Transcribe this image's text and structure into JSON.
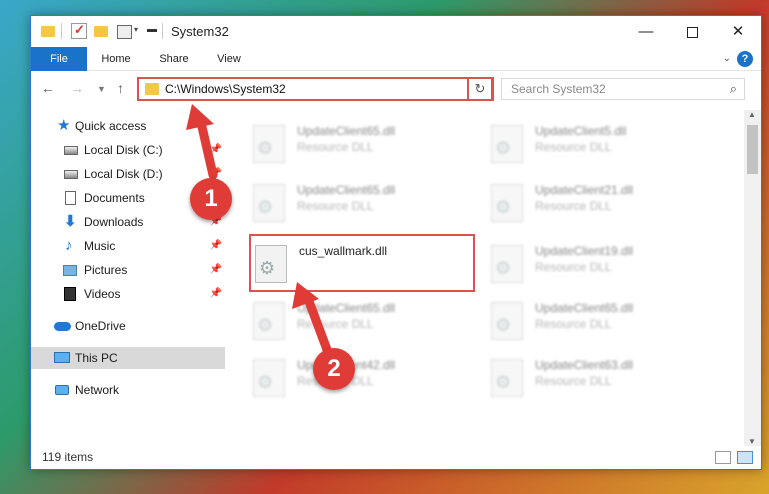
{
  "window": {
    "title": "System32",
    "buttons": {
      "minimize": "—",
      "close": "✕"
    }
  },
  "ribbon": {
    "tabs": [
      "File",
      "Home",
      "Share",
      "View"
    ],
    "help": "?"
  },
  "navigation": {
    "address": "C:\\Windows\\System32",
    "search_placeholder": "Search System32"
  },
  "nav_pane": {
    "items": [
      {
        "label": "Quick access",
        "icon": "star-icon"
      },
      {
        "label": "Local Disk (C:)",
        "icon": "disk-icon",
        "pinned": true
      },
      {
        "label": "Local Disk (D:)",
        "icon": "disk-icon",
        "pinned": true
      },
      {
        "label": "Documents",
        "icon": "documents-icon",
        "pinned": true
      },
      {
        "label": "Downloads",
        "icon": "downloads-icon",
        "pinned": true
      },
      {
        "label": "Music",
        "icon": "music-icon",
        "pinned": true
      },
      {
        "label": "Pictures",
        "icon": "pictures-icon",
        "pinned": true
      },
      {
        "label": "Videos",
        "icon": "videos-icon",
        "pinned": true
      },
      {
        "label": "OneDrive",
        "icon": "onedrive-icon"
      },
      {
        "label": "This PC",
        "icon": "this-pc-icon",
        "selected": true
      },
      {
        "label": "Network",
        "icon": "network-icon"
      }
    ]
  },
  "files": [
    {
      "name": "UpdateClient65.dll",
      "type": "Resource DLL",
      "blurred": true
    },
    {
      "name": "UpdateClient5.dll",
      "type": "Resource DLL",
      "blurred": true
    },
    {
      "name": "UpdateClient65.dll",
      "type": "Resource DLL",
      "blurred": true
    },
    {
      "name": "UpdateClient21.dll",
      "type": "Resource DLL",
      "blurred": true
    },
    {
      "name": "cus_wallmark.dll",
      "type": "",
      "blurred": false,
      "highlighted": true
    },
    {
      "name": "UpdateClient19.dll",
      "type": "Resource DLL",
      "blurred": true
    },
    {
      "name": "UpdateClient65.dll",
      "type": "Resource DLL",
      "blurred": true
    },
    {
      "name": "UpdateClient65.dll",
      "type": "Resource DLL",
      "blurred": true
    },
    {
      "name": "UpdateClient42.dll",
      "type": "Resource DLL",
      "blurred": true
    },
    {
      "name": "UpdateClient63.dll",
      "type": "Resource DLL",
      "blurred": true
    }
  ],
  "status": {
    "item_count": "119 items"
  },
  "annotations": {
    "step1": "1",
    "step2": "2",
    "color": "#df3b37"
  }
}
